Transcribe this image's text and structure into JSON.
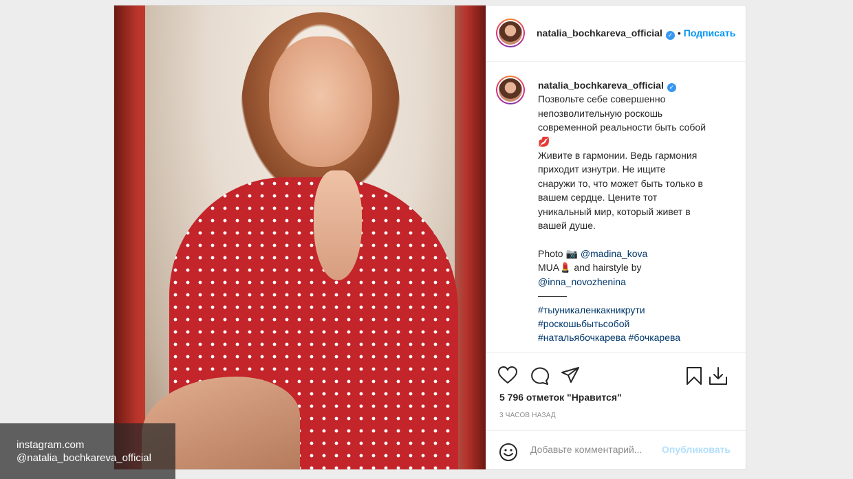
{
  "header": {
    "username": "natalia_bochkareva_official",
    "separator": "•",
    "follow_label": "Подписаться"
  },
  "caption": {
    "username": "natalia_bochkareva_official",
    "lines": [
      "Позвольте себе совершенно",
      "непозволительную роскошь",
      "современной реальности быть собой",
      "💋",
      "Живите в гармонии. Ведь гармония",
      "приходит изнутри. Не ищите",
      "снаружи то, что может быть только в",
      "вашем сердце. Цените тот",
      "уникальный мир, который живет в",
      "вашей душе."
    ],
    "photo_prefix": "Photo 📷",
    "photo_credit": "@madina_kova",
    "mua_prefix": "MUA💄 and hairstyle by",
    "mua_credit": "@inna_novozhenina",
    "divider": "———",
    "hashtags": [
      "#тыуникаленкакникрути",
      "#роскошьбытьсобой",
      "#натальябочкарева",
      "#бочкарева"
    ]
  },
  "stats": {
    "likes": "5 796 отметок \"Нравится\"",
    "time": "3 ЧАСОВ НАЗАД"
  },
  "comment_box": {
    "placeholder": "Добавьте комментарий...",
    "publish_label": "Опубликовать"
  },
  "watermark": {
    "site": "instagram.com",
    "account": "@natalia_bochkareva_official"
  },
  "icons": {
    "like": "heart-icon",
    "comment": "speech-bubble-icon",
    "share": "paper-plane-icon",
    "save": "bookmark-icon",
    "download": "download-icon",
    "emoji": "smiley-icon",
    "verified": "verified-badge-icon"
  },
  "colors": {
    "accent": "#0095f6",
    "verified": "#3897f0",
    "border": "#dbdbdb",
    "publish_disabled": "#b2dffc"
  }
}
